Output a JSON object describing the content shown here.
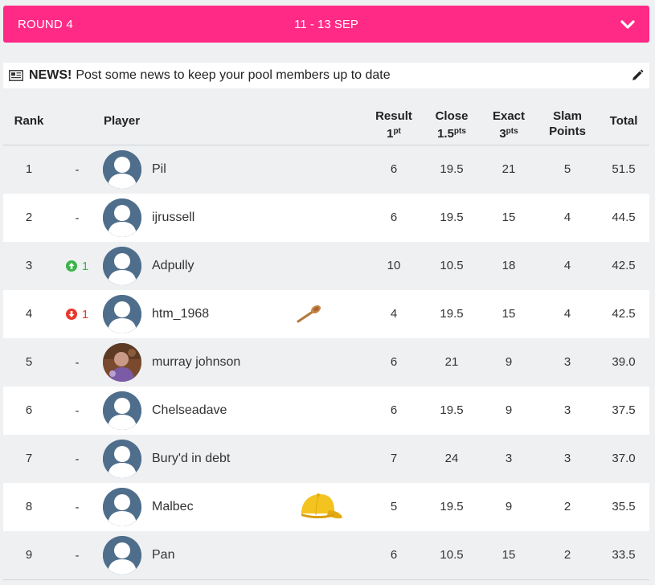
{
  "round": {
    "label": "ROUND 4",
    "dates": "11 - 13 SEP",
    "bar_color": "#ff2a85",
    "chevron_icon": "chevron-down-icon"
  },
  "news": {
    "icon": "newspaper-icon",
    "strong": "NEWS!",
    "text": "Post some news to keep your pool members up to date",
    "edit_icon": "pencil-icon"
  },
  "table": {
    "headers": {
      "rank": "Rank",
      "player": "Player",
      "result_line1": "Result",
      "result_line2": "1",
      "result_unit": "pt",
      "close_line1": "Close",
      "close_line2": "1.5",
      "close_unit": "pts",
      "exact_line1": "Exact",
      "exact_line2": "3",
      "exact_unit": "pts",
      "slam_line1": "Slam",
      "slam_line2": "Points",
      "total": "Total"
    },
    "colors": {
      "up": "#3bb54a",
      "down": "#e8392c",
      "avatar_bg": "#4f6e8c"
    },
    "rows": [
      {
        "rank": "1",
        "move": "-",
        "dir": "none",
        "player": "Pil",
        "result": "6",
        "close": "19.5",
        "exact": "21",
        "slam": "5",
        "total": "51.5",
        "badge": "",
        "avatar": "default"
      },
      {
        "rank": "2",
        "move": "-",
        "dir": "none",
        "player": "ijrussell",
        "result": "6",
        "close": "19.5",
        "exact": "15",
        "slam": "4",
        "total": "44.5",
        "badge": "",
        "avatar": "default"
      },
      {
        "rank": "3",
        "move": "1",
        "dir": "up",
        "player": "Adpully",
        "result": "10",
        "close": "10.5",
        "exact": "18",
        "slam": "4",
        "total": "42.5",
        "badge": "",
        "avatar": "default"
      },
      {
        "rank": "4",
        "move": "1",
        "dir": "down",
        "player": "htm_1968",
        "result": "4",
        "close": "19.5",
        "exact": "15",
        "slam": "4",
        "total": "42.5",
        "badge": "wooden-spoon-icon",
        "avatar": "default"
      },
      {
        "rank": "5",
        "move": "-",
        "dir": "none",
        "player": "murray johnson",
        "result": "6",
        "close": "21",
        "exact": "9",
        "slam": "3",
        "total": "39.0",
        "badge": "",
        "avatar": "photo"
      },
      {
        "rank": "6",
        "move": "-",
        "dir": "none",
        "player": "Chelseadave",
        "result": "6",
        "close": "19.5",
        "exact": "9",
        "slam": "3",
        "total": "37.5",
        "badge": "",
        "avatar": "default"
      },
      {
        "rank": "7",
        "move": "-",
        "dir": "none",
        "player": "Bury'd in debt",
        "result": "7",
        "close": "24",
        "exact": "3",
        "slam": "3",
        "total": "37.0",
        "badge": "",
        "avatar": "default"
      },
      {
        "rank": "8",
        "move": "-",
        "dir": "none",
        "player": "Malbec",
        "result": "5",
        "close": "19.5",
        "exact": "9",
        "slam": "2",
        "total": "35.5",
        "badge": "yellow-cap-icon",
        "avatar": "default"
      },
      {
        "rank": "9",
        "move": "-",
        "dir": "none",
        "player": "Pan",
        "result": "6",
        "close": "10.5",
        "exact": "15",
        "slam": "2",
        "total": "33.5",
        "badge": "",
        "avatar": "default"
      }
    ]
  }
}
